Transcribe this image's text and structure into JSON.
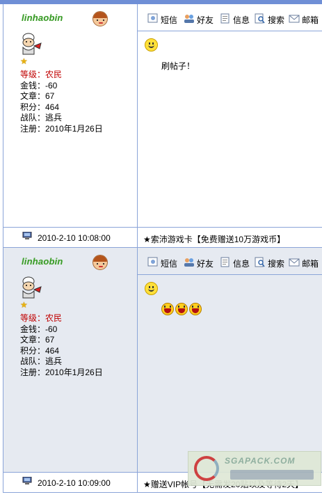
{
  "toolbar": {
    "items": [
      {
        "label": "短信",
        "icon": "sms-icon"
      },
      {
        "label": "好友",
        "icon": "friends-icon"
      },
      {
        "label": "信息",
        "icon": "info-icon"
      },
      {
        "label": "搜索",
        "icon": "search-icon"
      },
      {
        "label": "邮箱",
        "icon": "mail-icon"
      }
    ]
  },
  "posts": [
    {
      "user": {
        "name": "linhaobin",
        "level": "等级：农民",
        "money": "金钱：-60",
        "articles": "文章：67",
        "points": "积分：464",
        "team": "战队：逃兵",
        "registered": "注册：2010年1月26日"
      },
      "content": "刷帖子！",
      "time": "2010-2-10 10:08:00",
      "ad": "★索沛游戏卡【免费赠送10万游戏币】"
    },
    {
      "user": {
        "name": "linhaobin",
        "level": "等级：农民",
        "money": "金钱：-60",
        "articles": "文章：67",
        "points": "积分：464",
        "team": "战队：逃兵",
        "registered": "注册：2010年1月26日"
      },
      "content": "",
      "time": "2010-2-10 10:09:00",
      "ad": "★赠送VIP帐号【无需发20贴以及等待2天】"
    }
  ],
  "watermark": "SGAPACK.COM",
  "colors": {
    "border": "#8aa4d8",
    "alt_bg": "#e6eaf1",
    "level_red": "#c00000",
    "username_green": "#3a9a2a"
  }
}
